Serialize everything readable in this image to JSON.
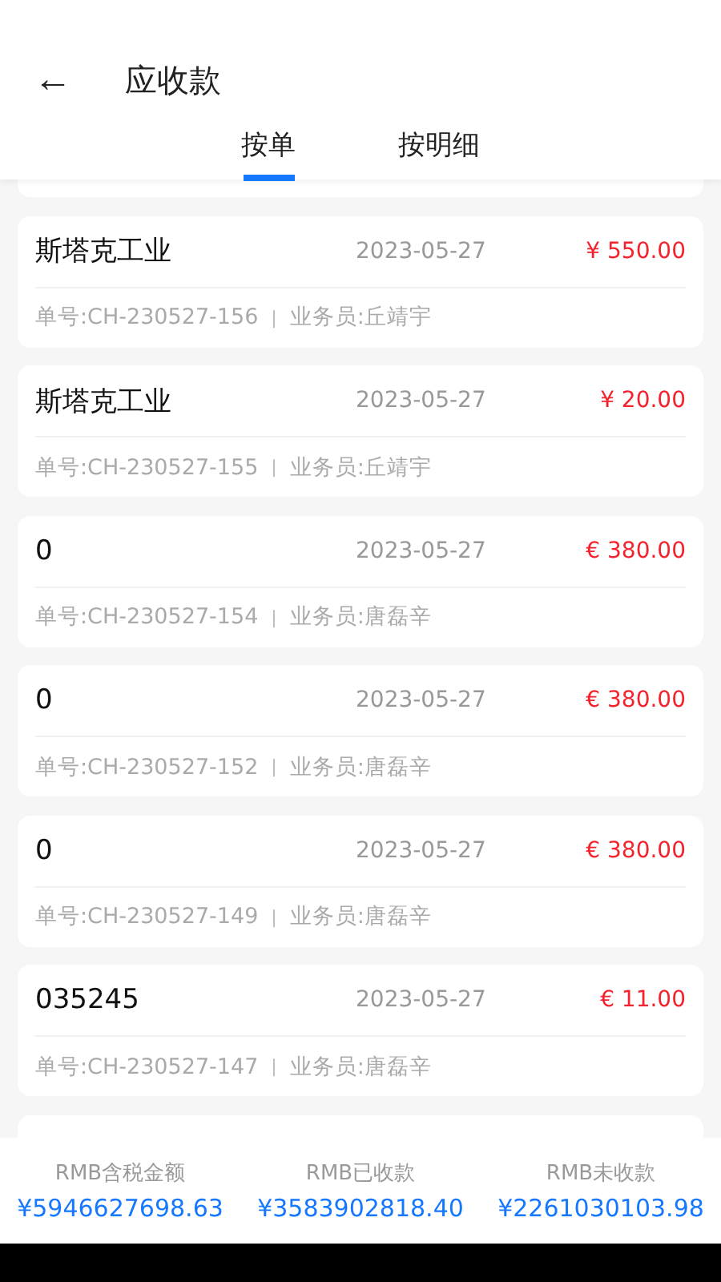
{
  "header": {
    "back": "←",
    "title": "应收款"
  },
  "tabs": [
    {
      "label": "按单",
      "selected": true
    },
    {
      "label": "按明细",
      "selected": false
    }
  ],
  "orders": [
    {
      "customer": "斯塔克工业",
      "date": "2023-05-27",
      "amount": "¥ 550.00",
      "order_no": "单号:CH-230527-156",
      "separator": "|",
      "salesperson": "业务员:丘靖宇"
    },
    {
      "customer": "斯塔克工业",
      "date": "2023-05-27",
      "amount": "¥ 20.00",
      "order_no": "单号:CH-230527-155",
      "separator": "|",
      "salesperson": "业务员:丘靖宇"
    },
    {
      "customer": "0",
      "date": "2023-05-27",
      "amount": "€ 380.00",
      "order_no": "单号:CH-230527-154",
      "separator": "|",
      "salesperson": "业务员:唐磊辛"
    },
    {
      "customer": "0",
      "date": "2023-05-27",
      "amount": "€ 380.00",
      "order_no": "单号:CH-230527-152",
      "separator": "|",
      "salesperson": "业务员:唐磊辛"
    },
    {
      "customer": "0",
      "date": "2023-05-27",
      "amount": "€ 380.00",
      "order_no": "单号:CH-230527-149",
      "separator": "|",
      "salesperson": "业务员:唐磊辛"
    },
    {
      "customer": "035245",
      "date": "2023-05-27",
      "amount": "€ 11.00",
      "order_no": "单号:CH-230527-147",
      "separator": "|",
      "salesperson": "业务员:唐磊辛"
    }
  ],
  "summary": [
    {
      "label": "RMB含税金额",
      "value": "¥5946627698.63"
    },
    {
      "label": "RMB已收款",
      "value": "¥3583902818.40"
    },
    {
      "label": "RMB未收款",
      "value": "¥2261030103.98"
    }
  ]
}
